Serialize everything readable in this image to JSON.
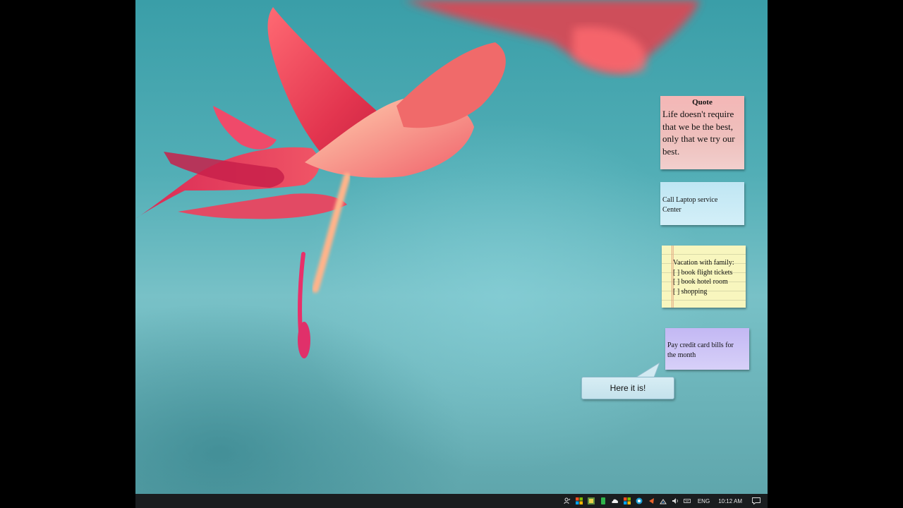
{
  "sticky_notes": {
    "quote": {
      "title": "Quote",
      "body": "Life doesn't require that we be the best, only that we try our best."
    },
    "laptop": {
      "line1": "Call Laptop service",
      "line2": "Center"
    },
    "vacation": {
      "lines": [
        "Vacation with family:",
        "[ ] book flight tickets",
        "[ ] book hotel room",
        "[ ] shopping"
      ]
    },
    "bills": {
      "line1": "Pay credit card bills for",
      "line2": "the month"
    }
  },
  "tooltip": {
    "text": "Here it is!"
  },
  "taskbar": {
    "language": "ENG",
    "clock": "10:12 AM",
    "tray_icons": [
      "people-icon",
      "app-icon-windows",
      "app-icon-colored",
      "app-icon-green",
      "onedrive-icon",
      "app-icon-windows-2",
      "app-icon-blue",
      "app-icon-orange",
      "network-icon",
      "volume-icon",
      "keyboard-icon"
    ]
  },
  "colors": {
    "quote_note": "#f4b7b6",
    "blue_note": "#bfe6f3",
    "yellow_note": "#f8f6be",
    "purple_note": "#c3b8f4",
    "tooltip": "#d7edf4",
    "taskbar": "#1a1d1f",
    "desktop": "#52aeb6",
    "flower": "#e3354f"
  }
}
